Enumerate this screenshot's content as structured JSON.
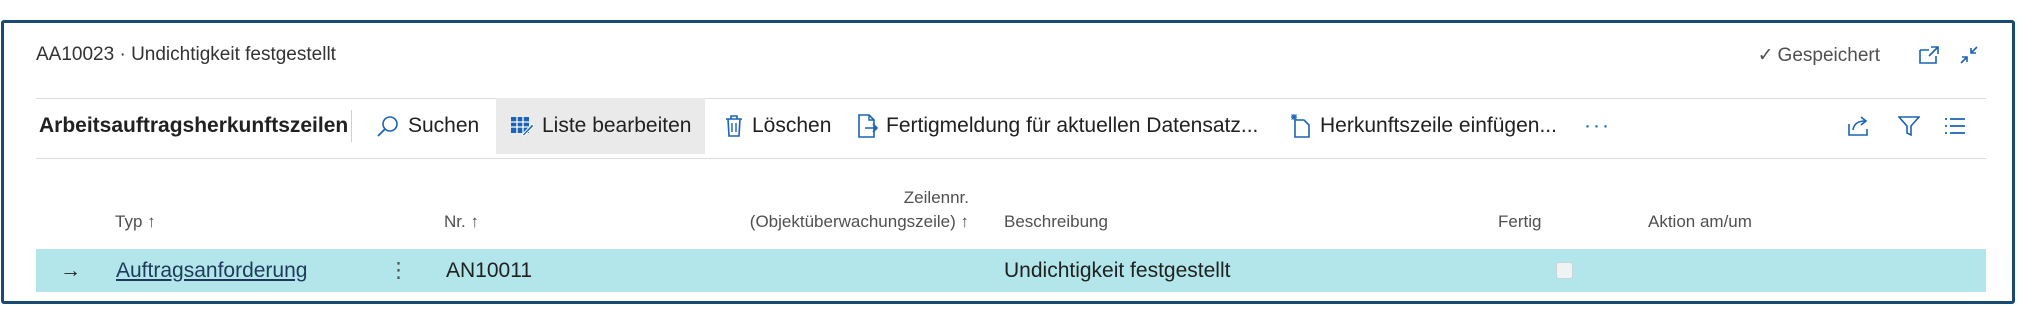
{
  "window": {
    "title": "AA10023 · Undichtigkeit festgestellt",
    "status": "Gespeichert"
  },
  "actionbar": {
    "page_name": "Arbeitsauftragsherkunftszeilen",
    "actions": [
      {
        "label": "Suchen",
        "icon": "search-icon"
      },
      {
        "label": "Liste bearbeiten",
        "icon": "edit-list-icon"
      },
      {
        "label": "Löschen",
        "icon": "trash-icon"
      },
      {
        "label": "Fertigmeldung für aktuellen Datensatz...",
        "icon": "document-arrow-icon"
      },
      {
        "label": "Herkunftszeile einfügen...",
        "icon": "insert-line-icon"
      }
    ],
    "more": "···"
  },
  "table": {
    "columns": {
      "typ": "Typ ↑",
      "nr": "Nr. ↑",
      "zeilennr_1": "Zeilennr.",
      "zeilennr_2": "(Objektüberwachungszeile) ↑",
      "beschreibung": "Beschreibung",
      "fertig": "Fertig",
      "aktion": "Aktion am/um"
    },
    "rows": [
      {
        "indicator": "→",
        "typ": "Auftragsanforderung",
        "menu": "⋮",
        "nr": "AN10011",
        "zeilennr": "",
        "beschreibung": "Undichtigkeit festgestellt",
        "fertig": false,
        "aktion": ""
      }
    ]
  },
  "colors": {
    "accent": "#1a63b5",
    "frame": "#1a4a72",
    "selected_row": "#b2e6ea"
  }
}
